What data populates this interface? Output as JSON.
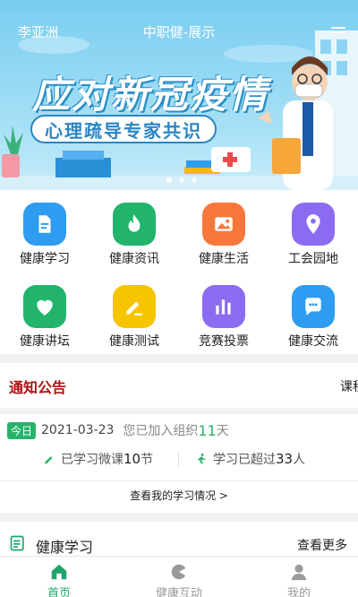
{
  "header": {
    "user_name": "李亚洲",
    "title": "中职健-展示"
  },
  "banner": {
    "headline": "应对新冠疫情",
    "subline": "心理疏导专家共识"
  },
  "menu": {
    "items": [
      {
        "label": "健康学习",
        "icon": "document-icon",
        "color": "#2e9cf0"
      },
      {
        "label": "健康资讯",
        "icon": "flame-icon",
        "color": "#22b46c"
      },
      {
        "label": "健康生活",
        "icon": "picture-icon",
        "color": "#f7783a"
      },
      {
        "label": "工会园地",
        "icon": "location-pin-icon",
        "color": "#8b6cf0"
      },
      {
        "label": "健康讲坛",
        "icon": "heart-icon",
        "color": "#22b46c"
      },
      {
        "label": "健康测试",
        "icon": "pencil-icon",
        "color": "#f7c400"
      },
      {
        "label": "竞赛投票",
        "icon": "bar-chart-icon",
        "color": "#8b6cf0"
      },
      {
        "label": "健康交流",
        "icon": "chat-bubble-icon",
        "color": "#2e9cf0"
      }
    ]
  },
  "notice": {
    "title": "通知公告",
    "scroll_text": "课程"
  },
  "study": {
    "today_badge": "今日",
    "date": "2021-03-23",
    "joined_prefix": "您已加入组织",
    "joined_days": "11",
    "joined_suffix": "天",
    "learned_prefix": "已学习微课",
    "learned_count": "10",
    "learned_suffix": "节",
    "surpass_prefix": "学习已超过",
    "surpass_count": "33",
    "surpass_suffix": "人",
    "view_link": "查看我的学习情况 >"
  },
  "section": {
    "title": "健康学习",
    "more": "查看更多"
  },
  "tabs": [
    {
      "label": "首页",
      "icon": "home-icon",
      "active": true
    },
    {
      "label": "健康互动",
      "icon": "chat-face-icon",
      "active": false
    },
    {
      "label": "我的",
      "icon": "user-icon",
      "active": false
    }
  ],
  "colors": {
    "accent": "#1fa56a",
    "notice_title": "#b01010",
    "banner_sky": "#79cdf0"
  }
}
